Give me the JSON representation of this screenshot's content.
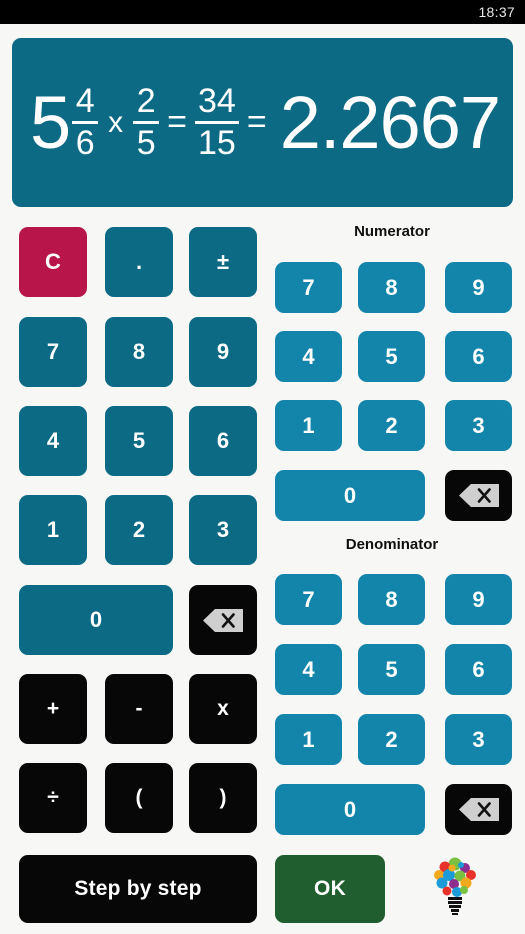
{
  "statusbar": {
    "time": "18:37"
  },
  "display": {
    "whole": "5",
    "frac1": {
      "num": "4",
      "den": "6"
    },
    "operator": "x",
    "frac2": {
      "num": "2",
      "den": "5"
    },
    "equals1": "=",
    "frac_result": {
      "num": "34",
      "den": "15"
    },
    "equals2": "=",
    "result": "2.2667"
  },
  "main_keypad": {
    "clear": "C",
    "decimal": ".",
    "sign": "±",
    "d7": "7",
    "d8": "8",
    "d9": "9",
    "d4": "4",
    "d5": "5",
    "d6": "6",
    "d1": "1",
    "d2": "2",
    "d3": "3",
    "d0": "0",
    "backspace": "backspace-icon",
    "plus": "+",
    "minus": "-",
    "times": "x",
    "divide": "÷",
    "paren_open": "(",
    "paren_close": ")",
    "step_by_step": "Step by step"
  },
  "numerator": {
    "label": "Numerator",
    "d7": "7",
    "d8": "8",
    "d9": "9",
    "d4": "4",
    "d5": "5",
    "d6": "6",
    "d1": "1",
    "d2": "2",
    "d3": "3",
    "d0": "0",
    "backspace": "backspace-icon"
  },
  "denominator": {
    "label": "Denominator",
    "d7": "7",
    "d8": "8",
    "d9": "9",
    "d4": "4",
    "d5": "5",
    "d6": "6",
    "d1": "1",
    "d2": "2",
    "d3": "3",
    "d0": "0",
    "backspace": "backspace-icon"
  },
  "actions": {
    "ok": "OK",
    "hint": "lightbulb-icon"
  },
  "colors": {
    "display_bg": "#0c6a84",
    "key_dark_teal": "#0c6a84",
    "key_light_teal": "#1485aa",
    "key_black": "#070707",
    "clear_red": "#b8164a",
    "ok_green": "#215e2f",
    "page_bg": "#f7f8f6",
    "statusbar_bg": "#000000"
  }
}
